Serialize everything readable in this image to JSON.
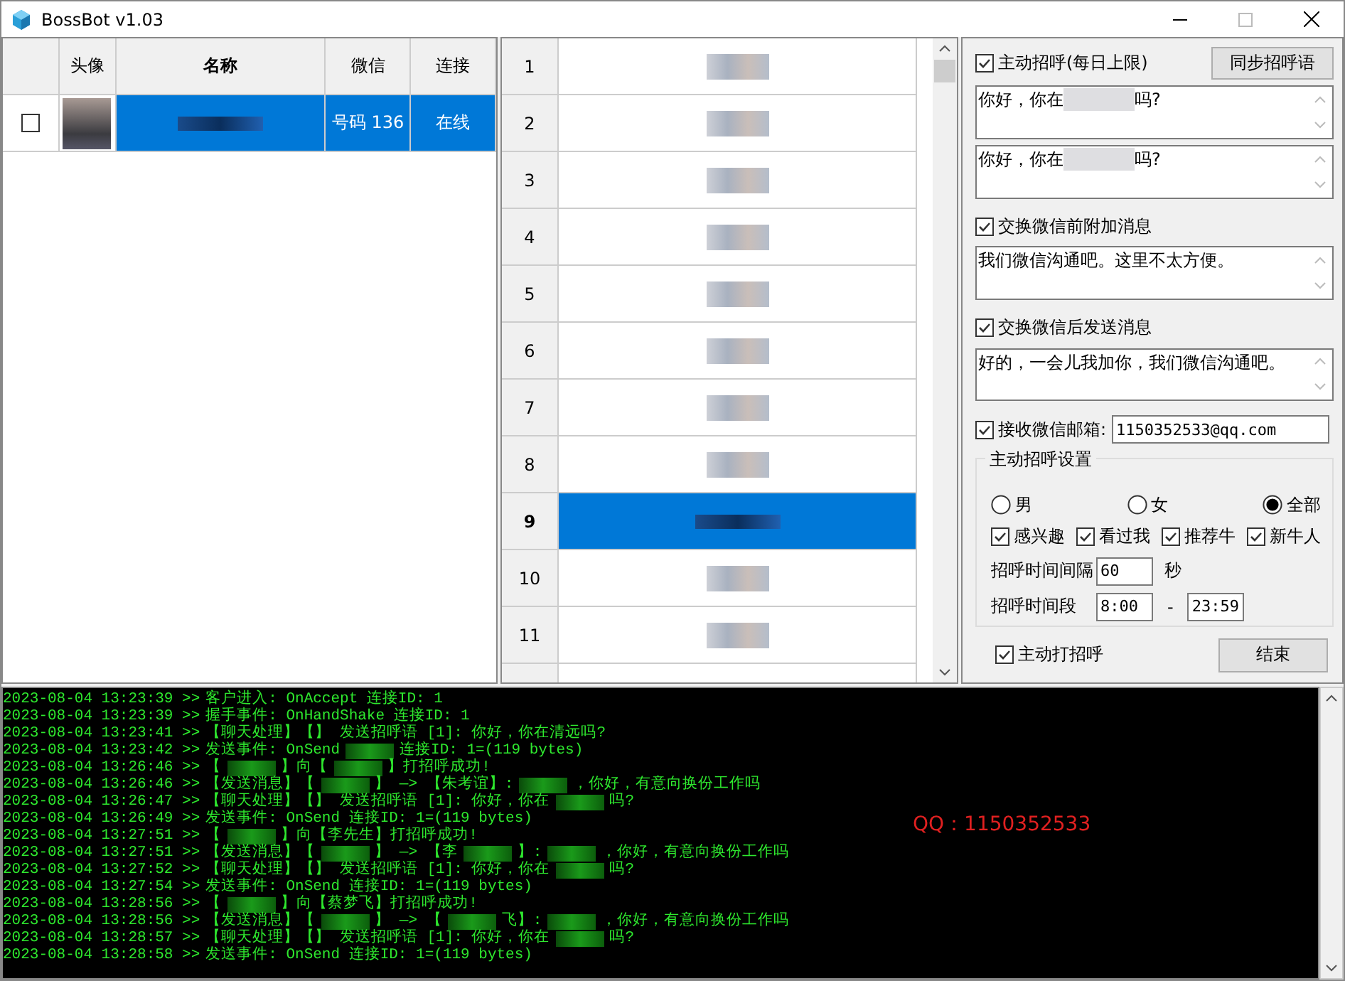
{
  "window": {
    "title": "BossBot v1.03"
  },
  "contacts_table": {
    "columns": [
      {
        "label": "头像",
        "bold": false
      },
      {
        "label": "名称",
        "bold": true
      },
      {
        "label": "微信",
        "bold": false
      },
      {
        "label": "连接",
        "bold": false
      }
    ],
    "rows": [
      {
        "checked": false,
        "wechat": "号码 136",
        "status": "在线",
        "selected": true
      }
    ]
  },
  "candidates": {
    "rows": [
      {
        "number": "1",
        "selected": false
      },
      {
        "number": "2",
        "selected": false
      },
      {
        "number": "3",
        "selected": false
      },
      {
        "number": "4",
        "selected": false
      },
      {
        "number": "5",
        "selected": false
      },
      {
        "number": "6",
        "selected": false
      },
      {
        "number": "7",
        "selected": false
      },
      {
        "number": "8",
        "selected": false
      },
      {
        "number": "9",
        "selected": true
      },
      {
        "number": "10",
        "selected": false
      },
      {
        "number": "11",
        "selected": false
      }
    ]
  },
  "settings": {
    "greeting": {
      "label": "主动招呼(每日上限)",
      "checked": true
    },
    "sync_button": "同步招呼语",
    "greetings": [
      {
        "before": "你好，你在",
        "after": "吗?"
      },
      {
        "before": "你好，你在",
        "after": "吗?"
      }
    ],
    "pre_exchange": {
      "label": "交换微信前附加消息",
      "checked": true,
      "message": "我们微信沟通吧。这里不太方便。"
    },
    "post_exchange": {
      "label": "交换微信后发送消息",
      "checked": true,
      "message": "好的，一会儿我加你，我们微信沟通吧。"
    },
    "email": {
      "label": "接收微信邮箱:",
      "checked": true,
      "value": "1150352533@qq.com"
    },
    "group": {
      "title": "主动招呼设置",
      "genders": [
        {
          "label": "男",
          "selected": false
        },
        {
          "label": "女",
          "selected": false
        },
        {
          "label": "全部",
          "selected": true
        }
      ],
      "filters": [
        {
          "label": "感兴趣",
          "checked": true
        },
        {
          "label": "看过我",
          "checked": true
        },
        {
          "label": "推荐牛",
          "checked": true
        },
        {
          "label": "新牛人",
          "checked": true
        }
      ],
      "interval": {
        "label": "招呼时间间隔",
        "value": "60",
        "unit": "秒"
      },
      "time_range": {
        "label": "招呼时间段",
        "start": "8:00",
        "separator": "-",
        "end": "23:59"
      }
    },
    "auto_greet": {
      "label": "主动打招呼",
      "checked": true
    },
    "end_button": "结束"
  },
  "log": {
    "overlay_text": "QQ：1150352533",
    "lines": [
      {
        "prefix": "2023-08-04 13:23:39 >>",
        "parts": [
          {
            "kind": "text",
            "text": "客户进入: OnAccept 连接ID: 1"
          }
        ]
      },
      {
        "prefix": "2023-08-04 13:23:39 >>",
        "parts": [
          {
            "kind": "text",
            "text": "握手事件: OnHandShake 连接ID: 1"
          }
        ]
      },
      {
        "prefix": "2023-08-04 13:23:41 >>",
        "parts": [
          {
            "kind": "text",
            "text": "【聊天处理】【】 发送招呼语 [1]: 你好，你在清远吗?"
          }
        ]
      },
      {
        "prefix": "2023-08-04 13:23:42 >>",
        "parts": [
          {
            "kind": "text",
            "text": "发送事件: OnSend"
          },
          {
            "kind": "blur"
          },
          {
            "kind": "text",
            "text": "连接ID: 1=(119 bytes)"
          }
        ]
      },
      {
        "prefix": "2023-08-04 13:26:46 >>",
        "parts": [
          {
            "kind": "text",
            "text": "【"
          },
          {
            "kind": "blur"
          },
          {
            "kind": "text",
            "text": "】向【"
          },
          {
            "kind": "blur"
          },
          {
            "kind": "text",
            "text": "】打招呼成功!"
          }
        ]
      },
      {
        "prefix": "2023-08-04 13:26:46 >>",
        "parts": [
          {
            "kind": "text",
            "text": "【发送消息】【"
          },
          {
            "kind": "blur"
          },
          {
            "kind": "text",
            "text": "】 —> 【朱考谊】:"
          },
          {
            "kind": "blur"
          },
          {
            "kind": "text",
            "text": "，你好，有意向换份工作吗"
          }
        ]
      },
      {
        "prefix": "2023-08-04 13:26:47 >>",
        "parts": [
          {
            "kind": "text",
            "text": "【聊天处理】【】 发送招呼语 [1]: 你好，你在"
          },
          {
            "kind": "blur"
          },
          {
            "kind": "text",
            "text": "吗?"
          }
        ]
      },
      {
        "prefix": "2023-08-04 13:26:49 >>",
        "parts": [
          {
            "kind": "text",
            "text": "发送事件: OnSend 连接ID: 1=(119 bytes)"
          }
        ]
      },
      {
        "prefix": "2023-08-04 13:27:51 >>",
        "parts": [
          {
            "kind": "text",
            "text": "【"
          },
          {
            "kind": "blur"
          },
          {
            "kind": "text",
            "text": "】向【李先生】打招呼成功!"
          }
        ]
      },
      {
        "prefix": "2023-08-04 13:27:51 >>",
        "parts": [
          {
            "kind": "text",
            "text": "【发送消息】【"
          },
          {
            "kind": "blur"
          },
          {
            "kind": "text",
            "text": "】 —> 【李"
          },
          {
            "kind": "blur"
          },
          {
            "kind": "text",
            "text": "】:"
          },
          {
            "kind": "blur"
          },
          {
            "kind": "text",
            "text": "，你好，有意向换份工作吗"
          }
        ]
      },
      {
        "prefix": "2023-08-04 13:27:52 >>",
        "parts": [
          {
            "kind": "text",
            "text": "【聊天处理】【】 发送招呼语 [1]: 你好，你在"
          },
          {
            "kind": "blur"
          },
          {
            "kind": "text",
            "text": "吗?"
          }
        ]
      },
      {
        "prefix": "2023-08-04 13:27:54 >>",
        "parts": [
          {
            "kind": "text",
            "text": "发送事件: OnSend 连接ID: 1=(119 bytes)"
          }
        ]
      },
      {
        "prefix": "2023-08-04 13:28:56 >>",
        "parts": [
          {
            "kind": "text",
            "text": "【"
          },
          {
            "kind": "blur"
          },
          {
            "kind": "text",
            "text": "】向【蔡梦飞】打招呼成功!"
          }
        ]
      },
      {
        "prefix": "2023-08-04 13:28:56 >>",
        "parts": [
          {
            "kind": "text",
            "text": "【发送消息】【"
          },
          {
            "kind": "blur"
          },
          {
            "kind": "text",
            "text": "】 —> 【"
          },
          {
            "kind": "blur"
          },
          {
            "kind": "text",
            "text": "飞】:"
          },
          {
            "kind": "blur"
          },
          {
            "kind": "text",
            "text": "，你好，有意向换份工作吗"
          }
        ]
      },
      {
        "prefix": "2023-08-04 13:28:57 >>",
        "parts": [
          {
            "kind": "text",
            "text": "【聊天处理】【】 发送招呼语 [1]: 你好，你在"
          },
          {
            "kind": "blur"
          },
          {
            "kind": "text",
            "text": "吗?"
          }
        ]
      },
      {
        "prefix": "2023-08-04 13:28:58 >>",
        "parts": [
          {
            "kind": "text",
            "text": "发送事件: OnSend 连接ID: 1=(119 bytes)"
          }
        ]
      }
    ]
  }
}
